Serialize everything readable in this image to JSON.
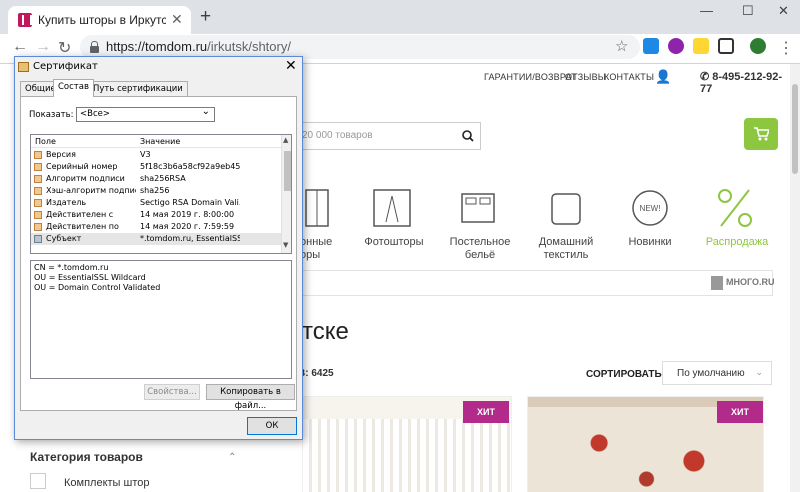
{
  "browser": {
    "tab_title": "Купить шторы в Иркутске недо",
    "url_domain": "https://tomdom.ru",
    "url_path": "/irkutsk/shtory/"
  },
  "site": {
    "top_nav": [
      "ГАРАНТИИ/ВОЗВРАТ",
      "ОТЗЫВЫ",
      "КОНТАКТЫ"
    ],
    "phone": "8-495-212-92-77",
    "search_placeholder": "20 000 товаров",
    "categories": [
      {
        "label": "онные",
        "label2": "оры",
        "icon": "curtains-icon"
      },
      {
        "label": "Фотошторы",
        "label2": "",
        "icon": "photo-curtains-icon"
      },
      {
        "label": "Постельное",
        "label2": "бельё",
        "icon": "bed-icon"
      },
      {
        "label": "Домашний",
        "label2": "текстиль",
        "icon": "pillow-icon"
      },
      {
        "label": "Новинки",
        "label2": "",
        "icon": "new-badge-icon"
      },
      {
        "label": "Распродажа",
        "label2": "",
        "icon": "percent-icon"
      }
    ],
    "promo_logo": "МНОГО.RU",
    "heading": "утске",
    "products_count": "В: 6425",
    "sort_label": "СОРТИРОВАТЬ",
    "sort_value": "По умолчанию",
    "badges": [
      "ХИТ",
      "ХИТ"
    ],
    "filter_title": "Категория товаров",
    "filter_item": "Комплекты штор",
    "colors": {
      "accent_green": "#8dc63f",
      "badge": "#b22a8a"
    }
  },
  "dialog": {
    "title": "Сертификат",
    "tabs": [
      "Общие",
      "Состав",
      "Путь сертификации"
    ],
    "show_label": "Показать:",
    "show_value": "<Все>",
    "col_field": "Поле",
    "col_value": "Значение",
    "rows": [
      {
        "field": "Версия",
        "value": "V3"
      },
      {
        "field": "Серийный номер",
        "value": "5f18c3b6a58cf92a9eb452..."
      },
      {
        "field": "Алгоритм подписи",
        "value": "sha256RSA"
      },
      {
        "field": "Хэш-алгоритм подписи",
        "value": "sha256"
      },
      {
        "field": "Издатель",
        "value": "Sectigo RSA Domain Vali..."
      },
      {
        "field": "Действителен с",
        "value": "14 мая 2019 г. 8:00:00"
      },
      {
        "field": "Действителен по",
        "value": "14 мая 2020 г. 7:59:59"
      },
      {
        "field": "Субъект",
        "value": "*.tomdom.ru, EssentialSS..."
      }
    ],
    "details": [
      "CN = *.tomdom.ru",
      "OU = EssentialSSL Wildcard",
      "OU = Domain Control Validated"
    ],
    "btn_props": "Свойства...",
    "btn_copy": "Копировать в файл...",
    "btn_ok": "ОК"
  }
}
